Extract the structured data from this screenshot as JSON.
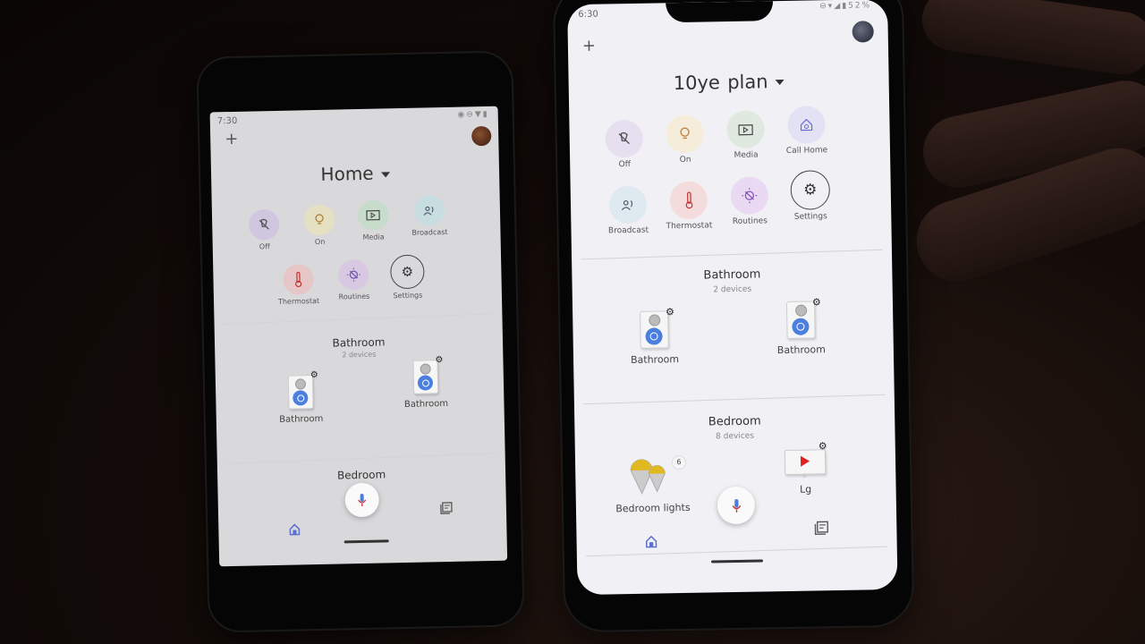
{
  "scene": {
    "description": "Two Android phones on a wooden table showing the Google Home app; a hand partially visible on the right."
  },
  "left_phone": {
    "status": {
      "time": "7:30",
      "icons": [
        "eye-icon",
        "dnd-icon",
        "wifi-icon",
        "battery-icon"
      ]
    },
    "header": {
      "home_name": "Home"
    },
    "actions": [
      {
        "label": "Off",
        "icon": "light-off-icon",
        "color": "#cfc7e0"
      },
      {
        "label": "On",
        "icon": "bulb-icon",
        "color": "#e6e0c2"
      },
      {
        "label": "Media",
        "icon": "media-icon",
        "color": "#c8dccb"
      },
      {
        "label": "Broadcast",
        "icon": "broadcast-icon",
        "color": "#c8dde0"
      },
      {
        "label": "Thermostat",
        "icon": "thermometer-icon",
        "color": "#e6c6c6"
      },
      {
        "label": "Routines",
        "icon": "routines-icon",
        "color": "#d8c8e2"
      },
      {
        "label": "Settings",
        "icon": "gear-icon",
        "color": "#d9d9dc"
      }
    ],
    "rooms": [
      {
        "name": "Bathroom",
        "count": "2 devices",
        "devices": [
          {
            "label": "Bathroom",
            "type": "speaker"
          },
          {
            "label": "Bathroom",
            "type": "speaker"
          }
        ]
      },
      {
        "name": "Bedroom"
      }
    ]
  },
  "right_phone": {
    "status": {
      "time": "6:30",
      "battery": "52%",
      "icons": [
        "dnd-icon",
        "wifi-icon",
        "signal-icon",
        "battery-icon"
      ]
    },
    "header": {
      "home_name": "10ye  plan"
    },
    "actions": [
      {
        "label": "Off",
        "icon": "light-off-icon",
        "color": "#e6dff0"
      },
      {
        "label": "On",
        "icon": "bulb-icon",
        "color": "#f5ecd9"
      },
      {
        "label": "Media",
        "icon": "media-icon",
        "color": "#dfe9e0"
      },
      {
        "label": "Call Home",
        "icon": "call-home-icon",
        "color": "#e3e2f5"
      },
      {
        "label": "Broadcast",
        "icon": "broadcast-icon",
        "color": "#dfeaf0"
      },
      {
        "label": "Thermostat",
        "icon": "thermometer-icon",
        "color": "#f5dcdc"
      },
      {
        "label": "Routines",
        "icon": "routines-icon",
        "color": "#ead9f2"
      },
      {
        "label": "Settings",
        "icon": "gear-icon",
        "color": "#f1f0f5"
      }
    ],
    "rooms": [
      {
        "name": "Bathroom",
        "count": "2 devices",
        "devices": [
          {
            "label": "Bathroom",
            "type": "speaker"
          },
          {
            "label": "Bathroom",
            "type": "speaker"
          }
        ]
      },
      {
        "name": "Bedroom",
        "count": "8 devices",
        "devices": [
          {
            "label": "Bedroom lights",
            "type": "lights",
            "badge": "6"
          },
          {
            "label": "Lg",
            "type": "tv"
          }
        ]
      }
    ]
  },
  "colors": {
    "accent_blue": "#4a7fe0",
    "nav_home_active": "#5a6fd0",
    "mic_blue": "#4a7fe0",
    "mic_red": "#d03030",
    "bulb_yellow": "#e0b820",
    "tv_red": "#e02020"
  }
}
